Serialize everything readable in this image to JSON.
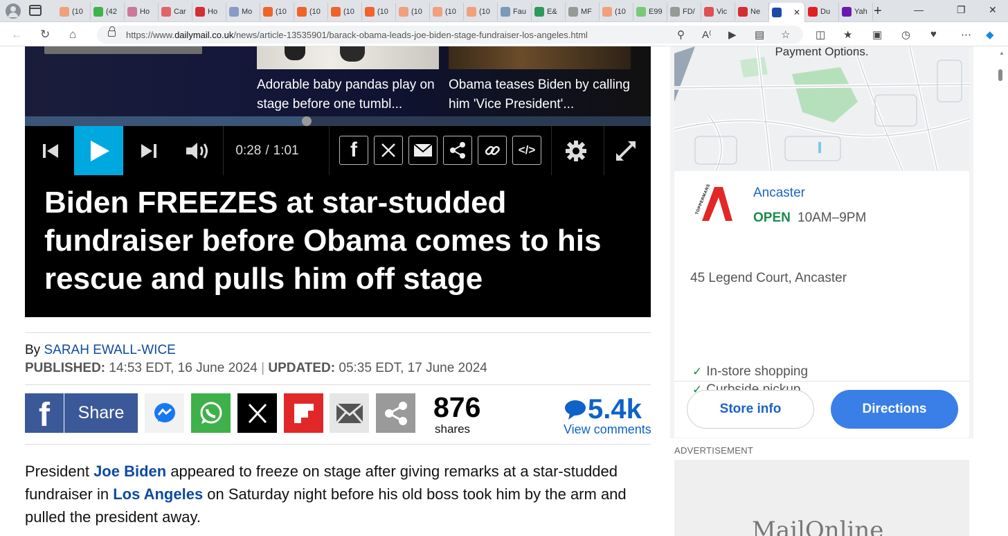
{
  "browser": {
    "tabs": [
      {
        "label": "(10",
        "color": "#f0a07a"
      },
      {
        "label": "(42",
        "color": "#3cb44b"
      },
      {
        "label": "Ho",
        "color": "#c97a9a"
      },
      {
        "label": "Car",
        "color": "#e06666"
      },
      {
        "label": "Ho",
        "color": "#d32f2f"
      },
      {
        "label": "Mo",
        "color": "#8a9ac8"
      },
      {
        "label": "(10",
        "color": "#f0642a"
      },
      {
        "label": "(10",
        "color": "#f0642a"
      },
      {
        "label": "(10",
        "color": "#f0642a"
      },
      {
        "label": "(10",
        "color": "#f0642a"
      },
      {
        "label": "(10",
        "color": "#f0a07a"
      },
      {
        "label": "(10",
        "color": "#f0a07a"
      },
      {
        "label": "(10",
        "color": "#f0a07a"
      },
      {
        "label": "Fau",
        "color": "#7a9ab8"
      },
      {
        "label": "E&",
        "color": "#2e9a5a"
      },
      {
        "label": "MF",
        "color": "#999999"
      },
      {
        "label": "(10",
        "color": "#f0a07a"
      },
      {
        "label": "E99",
        "color": "#7ac87a"
      },
      {
        "label": "FD/",
        "color": "#999999"
      },
      {
        "label": "Vic",
        "color": "#e05050"
      },
      {
        "label": "Ne",
        "color": "#d32f2f"
      },
      {
        "label": "",
        "color": "#1a4aa8",
        "active": true
      },
      {
        "label": "Du",
        "color": "#e02020"
      },
      {
        "label": "Yah",
        "color": "#6a1ab0"
      }
    ],
    "url_prefix": "https://www.",
    "url_domain": "dailymail.co.uk",
    "url_path": "/news/article-13535901/barack-obama-leads-joe-biden-stage-fundraiser-los-angeles.html"
  },
  "video": {
    "related": [
      {
        "title": "Adorable baby pandas play on stage before one tumbl..."
      },
      {
        "title": "Obama teases Biden by calling him 'Vice President'..."
      }
    ],
    "progress_fraction": 0.45,
    "time_current": "0:28",
    "time_separator": "/",
    "time_total": "1:01",
    "headline": "Biden FREEZES at star-studded fundraiser before Obama comes to his rescue and pulls him off stage"
  },
  "article": {
    "byline_prefix": "By",
    "author": "SARAH EWALL-WICE",
    "published_label": "PUBLISHED:",
    "published_value": "14:53 EDT, 16 June 2024",
    "updated_label": "UPDATED:",
    "updated_value": "05:35 EDT, 17 June 2024",
    "share_label": "Share",
    "share_count": "876",
    "shares_label": "shares",
    "comments_count": "5.4k",
    "view_comments": "View comments",
    "body_pre": "President ",
    "body_link1": "Joe Biden",
    "body_mid": " appeared to freeze on stage after giving remarks at a star-studded fundraiser in ",
    "body_link2": "Los Angeles",
    "body_post": " on Saturday night before his old boss took him by the arm and pulled the president away."
  },
  "sidebar": {
    "map_caption": "Payment Options.",
    "brand_logo_text": "TOPPERMANS",
    "store_name": "Ancaster",
    "store_status": "OPEN",
    "store_hours": "10AM–9PM",
    "store_address": "45 Legend Court, Ancaster",
    "features": [
      "In-store shopping",
      "Curbside pickup"
    ],
    "store_info_label": "Store info",
    "directions_label": "Directions",
    "advertisement_label": "ADVERTISEMENT",
    "ad_logo_text": "MailOnline"
  },
  "colors": {
    "accent_blue": "#0e62c8",
    "play_cyan": "#00a8e0",
    "facebook": "#3b5998",
    "whatsapp": "#3fb14a",
    "flipboard": "#e12828",
    "open_green": "#1a8a4a",
    "directions_blue": "#3a7ee8"
  }
}
